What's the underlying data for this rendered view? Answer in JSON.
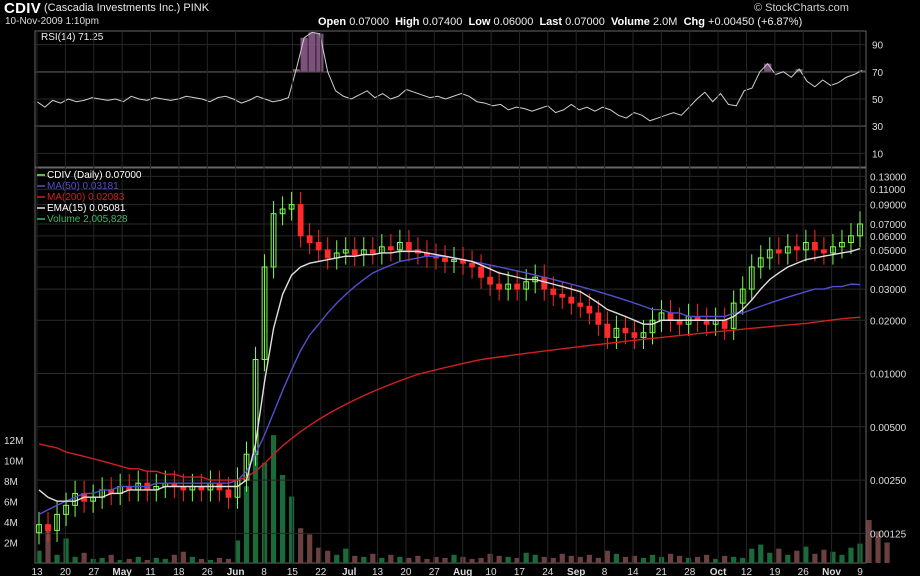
{
  "header": {
    "ticker": "CDIV",
    "company": "(Cascadia Investments Inc.)",
    "exchange": "PINK",
    "datetime": "10-Nov-2009 1:10pm",
    "logo": "© StockCharts.com",
    "open_label": "Open",
    "open": "0.07000",
    "high_label": "High",
    "high": "0.07400",
    "low_label": "Low",
    "low": "0.06000",
    "last_label": "Last",
    "last": "0.07000",
    "volume_label": "Volume",
    "volume": "2.0M",
    "chg_label": "Chg",
    "chg": "+0.00450 (+6.87%)"
  },
  "colors": {
    "background": "#000000",
    "grid": "#333333",
    "up_candle": "#7dff4a",
    "down_candle": "#ff2a2a",
    "ma50": "#5050d0",
    "ma200": "#d02020",
    "ema15": "#e0e0e0",
    "volume_up": "#1a6a3a",
    "volume_down": "#6a4040",
    "rsi_fill": "#8a5a8a"
  },
  "chart_data": [
    {
      "type": "line",
      "title": "RSI(14) 71.25",
      "y_ticks": [
        90,
        70,
        50,
        30,
        10
      ],
      "ylim": [
        0,
        100
      ],
      "reference_lines": [
        70,
        50,
        30
      ],
      "series": [
        {
          "name": "RSI(14)",
          "values": [
            48,
            44,
            49,
            47,
            50,
            48,
            49,
            51,
            50,
            49,
            50,
            48,
            52,
            50,
            49,
            51,
            50,
            49,
            50,
            52,
            51,
            50,
            48,
            51,
            52,
            50,
            47,
            49,
            52,
            50,
            48,
            49,
            51,
            72,
            95,
            99,
            98,
            70,
            56,
            52,
            50,
            53,
            56,
            51,
            54,
            50,
            52,
            57,
            55,
            53,
            51,
            52,
            50,
            52,
            54,
            52,
            48,
            47,
            45,
            46,
            42,
            44,
            43,
            41,
            43,
            45,
            40,
            42,
            46,
            42,
            44,
            41,
            44,
            42,
            38,
            36,
            40,
            38,
            34,
            36,
            38,
            40,
            38,
            44,
            50,
            55,
            48,
            54,
            46,
            45,
            56,
            58,
            70,
            76,
            68,
            70,
            66,
            72,
            63,
            59,
            64,
            60,
            62,
            66,
            68,
            71
          ]
        }
      ]
    },
    {
      "type": "line",
      "title": "CDIV (Daily) 0.07000",
      "yscale": "log",
      "y_ticks": [
        0.13,
        0.11,
        0.09,
        0.07,
        0.06,
        0.05,
        0.04,
        0.03,
        0.02,
        0.01,
        0.005,
        0.0025,
        0.00125
      ],
      "y_tick_labels": [
        "0.13000",
        "0.11000",
        "0.09000",
        "0.07000",
        "0.06000",
        "0.05000",
        "0.04000",
        "0.03000",
        "0.02000",
        "0.01000",
        "0.00500",
        "0.00250",
        "0.00125"
      ],
      "x_tick_labels": [
        "13",
        "20",
        "27",
        "May",
        "11",
        "18",
        "26",
        "Jun",
        "8",
        "15",
        "22",
        "Jul",
        "13",
        "20",
        "27",
        "Aug",
        "10",
        "17",
        "24",
        "Sep",
        "8",
        "14",
        "21",
        "28",
        "Oct",
        "12",
        "19",
        "26",
        "Nov",
        "9"
      ],
      "series": [
        {
          "name": "CDIV (Daily) 0.07000",
          "type": "candlestick",
          "close": [
            0.0014,
            0.0013,
            0.0016,
            0.0018,
            0.0021,
            0.0019,
            0.002,
            0.0022,
            0.0021,
            0.0023,
            0.0022,
            0.0024,
            0.0022,
            0.0023,
            0.0024,
            0.0023,
            0.0022,
            0.0023,
            0.0022,
            0.0024,
            0.0022,
            0.002,
            0.0025,
            0.0035,
            0.012,
            0.04,
            0.08,
            0.085,
            0.09,
            0.06,
            0.055,
            0.05,
            0.045,
            0.048,
            0.05,
            0.047,
            0.05,
            0.048,
            0.052,
            0.05,
            0.055,
            0.05,
            0.048,
            0.046,
            0.045,
            0.043,
            0.044,
            0.042,
            0.04,
            0.035,
            0.032,
            0.03,
            0.032,
            0.03,
            0.033,
            0.035,
            0.03,
            0.028,
            0.027,
            0.025,
            0.024,
            0.022,
            0.019,
            0.016,
            0.018,
            0.017,
            0.016,
            0.017,
            0.02,
            0.022,
            0.02,
            0.019,
            0.021,
            0.02,
            0.019,
            0.02,
            0.018,
            0.025,
            0.03,
            0.04,
            0.045,
            0.05,
            0.048,
            0.052,
            0.05,
            0.055,
            0.05,
            0.048,
            0.052,
            0.055,
            0.06,
            0.07
          ]
        },
        {
          "name": "MA(50) 0.03181",
          "values": [
            0.0016,
            0.0017,
            0.0018,
            0.0019,
            0.002,
            0.0021,
            0.0021,
            0.0022,
            0.0022,
            0.0023,
            0.0023,
            0.0023,
            0.0023,
            0.0024,
            0.0024,
            0.0024,
            0.0024,
            0.0024,
            0.0024,
            0.0024,
            0.0024,
            0.0024,
            0.0025,
            0.0028,
            0.0035,
            0.0045,
            0.006,
            0.008,
            0.0105,
            0.0135,
            0.0165,
            0.019,
            0.022,
            0.025,
            0.028,
            0.031,
            0.034,
            0.037,
            0.039,
            0.041,
            0.043,
            0.044,
            0.045,
            0.046,
            0.046,
            0.046,
            0.045,
            0.044,
            0.043,
            0.042,
            0.041,
            0.04,
            0.039,
            0.038,
            0.037,
            0.036,
            0.035,
            0.034,
            0.033,
            0.032,
            0.031,
            0.03,
            0.029,
            0.028,
            0.027,
            0.026,
            0.025,
            0.024,
            0.023,
            0.023,
            0.022,
            0.022,
            0.021,
            0.021,
            0.021,
            0.021,
            0.021,
            0.022,
            0.022,
            0.023,
            0.024,
            0.025,
            0.026,
            0.027,
            0.028,
            0.029,
            0.03,
            0.03,
            0.031,
            0.031,
            0.032,
            0.0318
          ]
        },
        {
          "name": "MA(200) 0.02083",
          "values": [
            0.004,
            0.0039,
            0.0038,
            0.0036,
            0.0035,
            0.0034,
            0.0033,
            0.0032,
            0.0031,
            0.003,
            0.0029,
            0.0029,
            0.0028,
            0.0028,
            0.0027,
            0.0027,
            0.0026,
            0.0026,
            0.0026,
            0.0025,
            0.0025,
            0.0025,
            0.0025,
            0.0026,
            0.0028,
            0.0031,
            0.0035,
            0.0039,
            0.0043,
            0.0047,
            0.0051,
            0.0055,
            0.0059,
            0.0063,
            0.0067,
            0.0071,
            0.0075,
            0.0079,
            0.0083,
            0.0087,
            0.0091,
            0.0095,
            0.0099,
            0.0102,
            0.0105,
            0.0108,
            0.0111,
            0.0114,
            0.0117,
            0.012,
            0.0122,
            0.0124,
            0.0126,
            0.0128,
            0.013,
            0.0132,
            0.0134,
            0.0136,
            0.0138,
            0.014,
            0.0142,
            0.0144,
            0.0146,
            0.0148,
            0.015,
            0.0152,
            0.0154,
            0.0156,
            0.0158,
            0.016,
            0.0162,
            0.0164,
            0.0166,
            0.0168,
            0.017,
            0.0172,
            0.0174,
            0.0176,
            0.0178,
            0.018,
            0.0182,
            0.0184,
            0.0186,
            0.0188,
            0.019,
            0.0192,
            0.0195,
            0.0198,
            0.0201,
            0.0204,
            0.0206,
            0.0208
          ]
        },
        {
          "name": "EMA(15) 0.05081",
          "values": [
            0.0022,
            0.002,
            0.0019,
            0.0019,
            0.0019,
            0.002,
            0.002,
            0.002,
            0.0021,
            0.0021,
            0.0022,
            0.0022,
            0.0022,
            0.0022,
            0.0023,
            0.0023,
            0.0023,
            0.0023,
            0.0023,
            0.0023,
            0.0023,
            0.0023,
            0.0023,
            0.0025,
            0.004,
            0.009,
            0.018,
            0.028,
            0.036,
            0.04,
            0.042,
            0.043,
            0.044,
            0.045,
            0.046,
            0.046,
            0.047,
            0.047,
            0.048,
            0.048,
            0.049,
            0.049,
            0.049,
            0.048,
            0.047,
            0.046,
            0.045,
            0.044,
            0.043,
            0.041,
            0.039,
            0.037,
            0.036,
            0.035,
            0.034,
            0.034,
            0.033,
            0.032,
            0.031,
            0.03,
            0.029,
            0.027,
            0.025,
            0.023,
            0.022,
            0.021,
            0.02,
            0.019,
            0.019,
            0.02,
            0.02,
            0.02,
            0.02,
            0.02,
            0.02,
            0.02,
            0.02,
            0.021,
            0.023,
            0.026,
            0.03,
            0.034,
            0.037,
            0.04,
            0.042,
            0.044,
            0.045,
            0.046,
            0.047,
            0.048,
            0.049,
            0.0508
          ]
        }
      ]
    },
    {
      "type": "bar",
      "title": "Volume 2,005,828",
      "y_tick_labels": [
        "12M",
        "10M",
        "8M",
        "6M",
        "4M",
        "2M"
      ],
      "y_ticks": [
        12,
        10,
        8,
        6,
        4,
        2
      ],
      "ylim": [
        0,
        13
      ],
      "unit": "millions",
      "values": [
        1.2,
        3.2,
        0.8,
        2.4,
        0.6,
        1.0,
        0.4,
        0.5,
        0.8,
        0.3,
        0.4,
        0.6,
        0.3,
        0.5,
        0.4,
        0.8,
        1.1,
        0.6,
        0.4,
        0.3,
        0.5,
        0.4,
        2.2,
        7.5,
        11.0,
        9.8,
        12.5,
        8.6,
        6.5,
        3.4,
        2.8,
        1.5,
        1.2,
        0.8,
        1.4,
        0.7,
        0.6,
        0.9,
        0.5,
        0.8,
        0.6,
        0.5,
        0.7,
        0.4,
        0.6,
        0.5,
        0.8,
        0.6,
        0.4,
        0.5,
        0.9,
        0.7,
        0.6,
        0.5,
        1.0,
        0.8,
        0.6,
        0.5,
        0.9,
        0.7,
        0.6,
        0.8,
        0.5,
        1.2,
        0.9,
        0.6,
        0.7,
        0.5,
        0.8,
        0.6,
        0.9,
        0.7,
        0.5,
        0.6,
        0.8,
        0.4,
        0.7,
        0.6,
        0.5,
        1.4,
        1.8,
        1.0,
        1.4,
        0.8,
        1.2,
        1.6,
        0.9,
        1.3,
        1.1,
        0.8,
        1.5,
        1.9,
        4.2,
        3.1,
        2.0
      ]
    }
  ]
}
